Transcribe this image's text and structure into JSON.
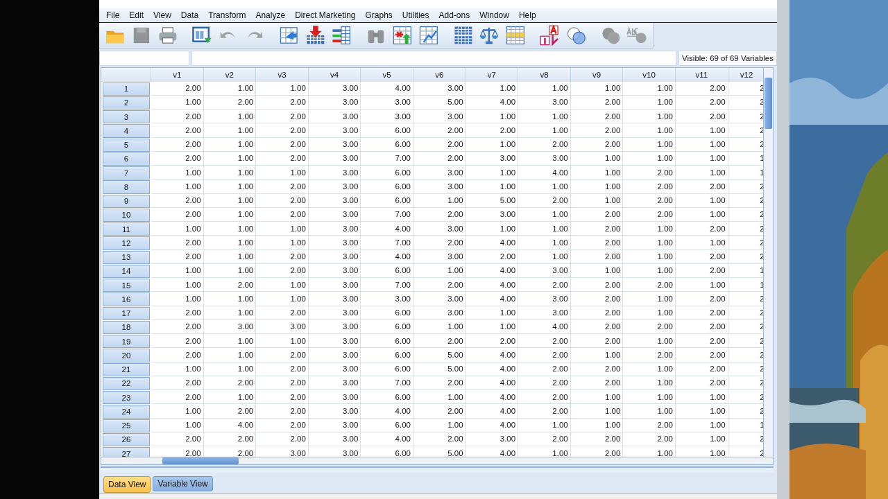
{
  "menu": [
    "File",
    "Edit",
    "View",
    "Data",
    "Transform",
    "Analyze",
    "Direct Marketing",
    "Graphs",
    "Utilities",
    "Add-ons",
    "Window",
    "Help"
  ],
  "toolbar": [
    {
      "kind": "folder",
      "disabled": false
    },
    {
      "kind": "disk",
      "disabled": true
    },
    {
      "kind": "printer",
      "disabled": false
    },
    {
      "kind": "recall",
      "disabled": false
    },
    {
      "kind": "undo",
      "disabled": true
    },
    {
      "kind": "redo",
      "disabled": true
    },
    {
      "kind": "gotocase",
      "disabled": false
    },
    {
      "kind": "gotovar",
      "disabled": false
    },
    {
      "kind": "variables",
      "disabled": false
    },
    {
      "kind": "find",
      "disabled": true
    },
    {
      "kind": "insertcase",
      "disabled": false
    },
    {
      "kind": "insertvar",
      "disabled": false
    },
    {
      "kind": "split",
      "disabled": false
    },
    {
      "kind": "weight",
      "disabled": false
    },
    {
      "kind": "select",
      "disabled": false
    },
    {
      "kind": "labels",
      "disabled": false
    },
    {
      "kind": "sets",
      "disabled": false
    },
    {
      "kind": "showall",
      "disabled": true
    },
    {
      "kind": "spell",
      "disabled": true
    }
  ],
  "cell_editor": {
    "visible_variables": "Visible: 69 of 69 Variables"
  },
  "grid": {
    "columns": [
      "v1",
      "v2",
      "v3",
      "v4",
      "v5",
      "v6",
      "v7",
      "v8",
      "v9",
      "v10",
      "v11",
      "v12"
    ],
    "rows": [
      {
        "case": "1",
        "values": [
          "2.00",
          "1.00",
          "1.00",
          "3.00",
          "4.00",
          "3.00",
          "1.00",
          "1.00",
          "1.00",
          "1.00",
          "2.00",
          "2"
        ]
      },
      {
        "case": "2",
        "values": [
          "1.00",
          "2.00",
          "2.00",
          "3.00",
          "3.00",
          "5.00",
          "4.00",
          "3.00",
          "2.00",
          "1.00",
          "2.00",
          "2"
        ]
      },
      {
        "case": "3",
        "values": [
          "2.00",
          "1.00",
          "2.00",
          "3.00",
          "3.00",
          "3.00",
          "1.00",
          "1.00",
          "2.00",
          "1.00",
          "2.00",
          "2"
        ]
      },
      {
        "case": "4",
        "values": [
          "2.00",
          "1.00",
          "2.00",
          "3.00",
          "6.00",
          "2.00",
          "2.00",
          "1.00",
          "2.00",
          "1.00",
          "1.00",
          "2"
        ]
      },
      {
        "case": "5",
        "values": [
          "2.00",
          "1.00",
          "2.00",
          "3.00",
          "6.00",
          "2.00",
          "1.00",
          "2.00",
          "2.00",
          "1.00",
          "1.00",
          "2"
        ]
      },
      {
        "case": "6",
        "values": [
          "2.00",
          "1.00",
          "2.00",
          "3.00",
          "7.00",
          "2.00",
          "3.00",
          "3.00",
          "1.00",
          "1.00",
          "1.00",
          "1"
        ]
      },
      {
        "case": "7",
        "values": [
          "1.00",
          "1.00",
          "1.00",
          "3.00",
          "6.00",
          "3.00",
          "1.00",
          "4.00",
          "1.00",
          "2.00",
          "1.00",
          "1"
        ]
      },
      {
        "case": "8",
        "values": [
          "1.00",
          "1.00",
          "2.00",
          "3.00",
          "6.00",
          "3.00",
          "1.00",
          "1.00",
          "1.00",
          "2.00",
          "2.00",
          "2"
        ]
      },
      {
        "case": "9",
        "values": [
          "2.00",
          "1.00",
          "2.00",
          "3.00",
          "6.00",
          "1.00",
          "5.00",
          "2.00",
          "1.00",
          "2.00",
          "1.00",
          "2"
        ]
      },
      {
        "case": "10",
        "values": [
          "2.00",
          "1.00",
          "2.00",
          "3.00",
          "7.00",
          "2.00",
          "3.00",
          "1.00",
          "2.00",
          "2.00",
          "1.00",
          "2"
        ]
      },
      {
        "case": "11",
        "values": [
          "1.00",
          "1.00",
          "1.00",
          "3.00",
          "4.00",
          "3.00",
          "1.00",
          "1.00",
          "2.00",
          "1.00",
          "2.00",
          "2"
        ]
      },
      {
        "case": "12",
        "values": [
          "2.00",
          "1.00",
          "1.00",
          "3.00",
          "7.00",
          "2.00",
          "4.00",
          "1.00",
          "2.00",
          "1.00",
          "1.00",
          "2"
        ]
      },
      {
        "case": "13",
        "values": [
          "2.00",
          "1.00",
          "2.00",
          "3.00",
          "4.00",
          "3.00",
          "2.00",
          "1.00",
          "2.00",
          "1.00",
          "2.00",
          "2"
        ]
      },
      {
        "case": "14",
        "values": [
          "1.00",
          "1.00",
          "2.00",
          "3.00",
          "6.00",
          "1.00",
          "4.00",
          "3.00",
          "1.00",
          "1.00",
          "2.00",
          "1"
        ]
      },
      {
        "case": "15",
        "values": [
          "1.00",
          "2.00",
          "1.00",
          "3.00",
          "7.00",
          "2.00",
          "4.00",
          "2.00",
          "2.00",
          "2.00",
          "1.00",
          "1"
        ]
      },
      {
        "case": "16",
        "values": [
          "1.00",
          "1.00",
          "1.00",
          "3.00",
          "3.00",
          "3.00",
          "4.00",
          "3.00",
          "2.00",
          "1.00",
          "2.00",
          "2"
        ]
      },
      {
        "case": "17",
        "values": [
          "2.00",
          "1.00",
          "2.00",
          "3.00",
          "6.00",
          "3.00",
          "1.00",
          "3.00",
          "2.00",
          "1.00",
          "2.00",
          "2"
        ]
      },
      {
        "case": "18",
        "values": [
          "2.00",
          "3.00",
          "3.00",
          "3.00",
          "6.00",
          "1.00",
          "1.00",
          "4.00",
          "2.00",
          "2.00",
          "2.00",
          "2"
        ]
      },
      {
        "case": "19",
        "values": [
          "2.00",
          "1.00",
          "1.00",
          "3.00",
          "6.00",
          "2.00",
          "2.00",
          "2.00",
          "2.00",
          "1.00",
          "2.00",
          "2"
        ]
      },
      {
        "case": "20",
        "values": [
          "2.00",
          "1.00",
          "2.00",
          "3.00",
          "6.00",
          "5.00",
          "4.00",
          "2.00",
          "1.00",
          "2.00",
          "2.00",
          "2"
        ]
      },
      {
        "case": "21",
        "values": [
          "1.00",
          "1.00",
          "2.00",
          "3.00",
          "6.00",
          "5.00",
          "4.00",
          "2.00",
          "2.00",
          "1.00",
          "2.00",
          "2"
        ]
      },
      {
        "case": "22",
        "values": [
          "2.00",
          "2.00",
          "2.00",
          "3.00",
          "7.00",
          "2.00",
          "4.00",
          "2.00",
          "2.00",
          "1.00",
          "2.00",
          "2"
        ]
      },
      {
        "case": "23",
        "values": [
          "2.00",
          "1.00",
          "2.00",
          "3.00",
          "6.00",
          "1.00",
          "4.00",
          "2.00",
          "1.00",
          "1.00",
          "1.00",
          "2"
        ]
      },
      {
        "case": "24",
        "values": [
          "1.00",
          "2.00",
          "2.00",
          "3.00",
          "4.00",
          "2.00",
          "4.00",
          "2.00",
          "1.00",
          "1.00",
          "1.00",
          "2"
        ]
      },
      {
        "case": "25",
        "values": [
          "1.00",
          "4.00",
          "2.00",
          "3.00",
          "6.00",
          "1.00",
          "4.00",
          "1.00",
          "1.00",
          "2.00",
          "1.00",
          "1"
        ]
      },
      {
        "case": "26",
        "values": [
          "2.00",
          "2.00",
          "2.00",
          "3.00",
          "4.00",
          "2.00",
          "3.00",
          "2.00",
          "2.00",
          "2.00",
          "1.00",
          "2"
        ]
      },
      {
        "case": "27",
        "values": [
          "2.00",
          "2.00",
          "3.00",
          "3.00",
          "6.00",
          "5.00",
          "4.00",
          "1.00",
          "2.00",
          "1.00",
          "1.00",
          "2"
        ]
      }
    ]
  },
  "tabs": [
    {
      "label": "Data View",
      "selected": true
    },
    {
      "label": "Variable View",
      "selected": false
    }
  ]
}
